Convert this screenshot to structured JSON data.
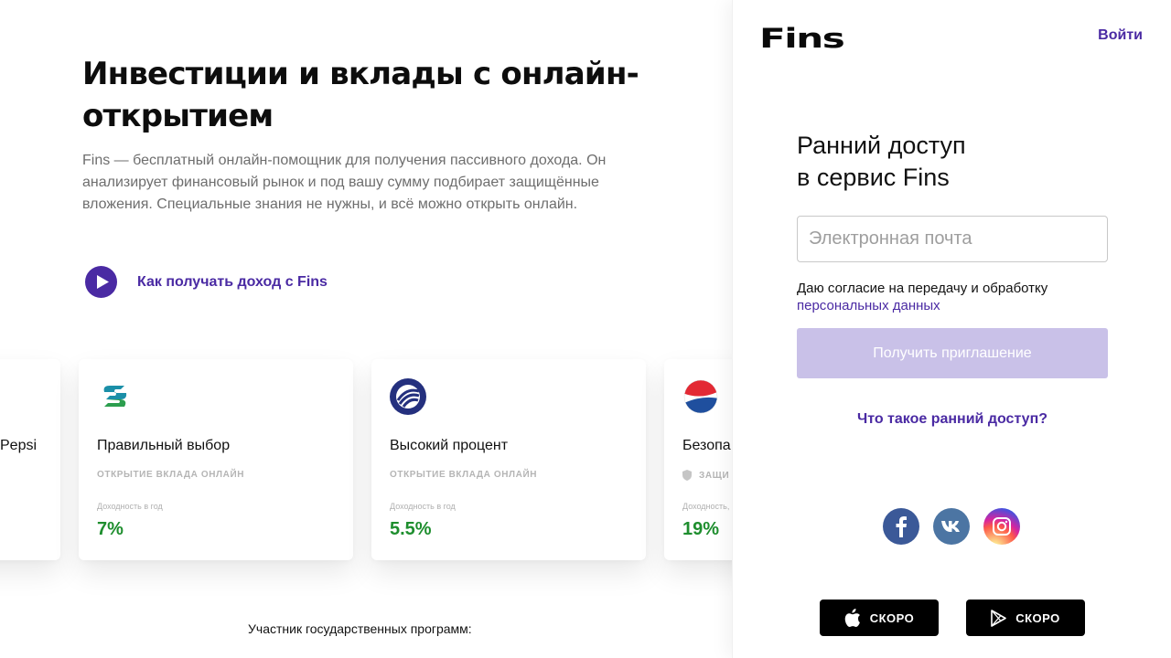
{
  "hero": {
    "title": "Инвестиции и вклады с онлайн-открытием",
    "description": "Fins — бесплатный онлайн-помощник для получения пассивного дохода. Он анализирует финансовый рынок и под вашу сумму подбирает защищённые вложения. Специальные знания не нужны, и всё можно открыть онлайн.",
    "video_link": "Как получать доход с Fins"
  },
  "cards": [
    {
      "title": "Pepsi",
      "tag": "",
      "yield_label": "",
      "rate": ""
    },
    {
      "title": "Правильный выбор",
      "tag": "ОТКРЫТИЕ ВКЛАДА ОНЛАЙН",
      "yield_label": "Доходность в год",
      "rate": "7%",
      "logo": "sovcombank-logo"
    },
    {
      "title": "Высокий процент",
      "tag": "ОТКРЫТИЕ ВКЛАДА ОНЛАЙН",
      "yield_label": "Доходность в год",
      "rate": "5.5%",
      "logo": "bank-logo-blue"
    },
    {
      "title": "Безопа",
      "tag": "ЗАЩИ",
      "yield_label": "Доходность,",
      "rate": "19%",
      "logo": "pepsi-logo"
    }
  ],
  "participant_text": "Участник государственных программ:",
  "panel": {
    "brand": "Fins",
    "login": "Войти",
    "heading_line1": "Ранний доступ",
    "heading_line2": "в сервис Fins",
    "email_placeholder": "Электронная почта",
    "consent_text": "Даю согласие на передачу и обработку",
    "consent_link": "персональных данных",
    "invite_button": "Получить приглашение",
    "early_access_link": "Что такое ранний доступ?",
    "store_apple": "СКОРО",
    "store_google": "СКОРО"
  },
  "colors": {
    "accent": "#4a2aa3",
    "button_disabled": "#c9c1e8",
    "rate_green": "#1e8e2e"
  }
}
